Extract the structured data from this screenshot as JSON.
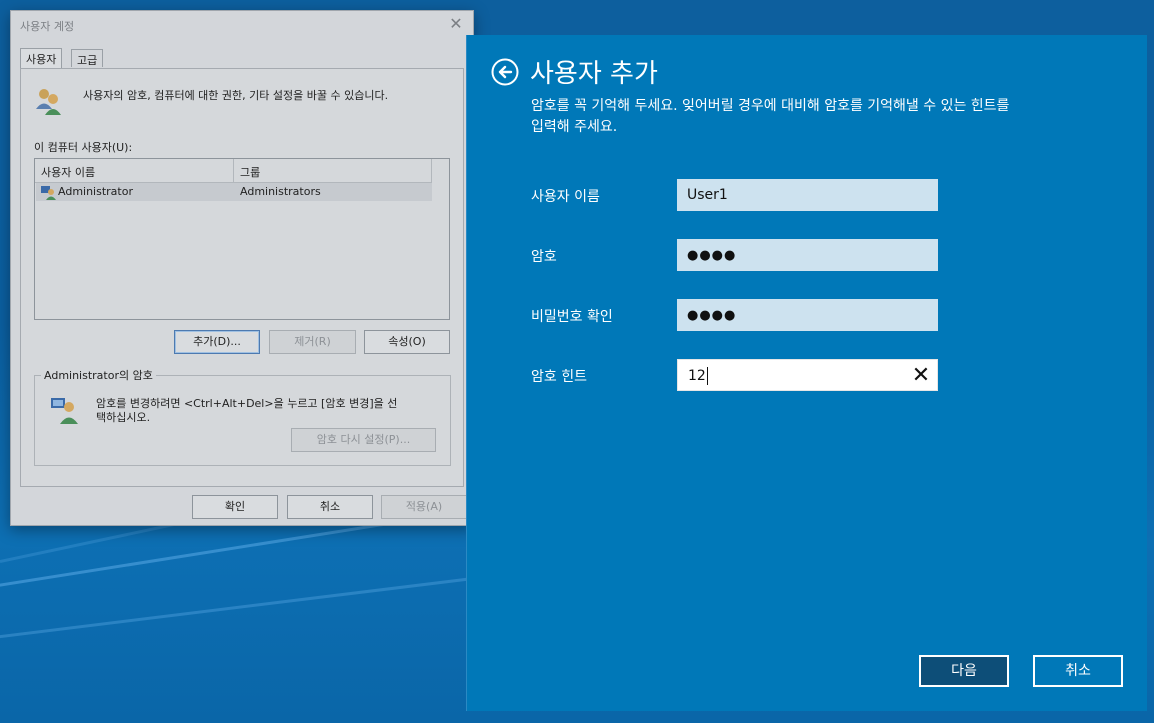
{
  "colors": {
    "desktop": "#0b5fa0",
    "modern_panel": "#0078b8",
    "field_bg": "#cde2ef",
    "next_button_bg": "#0d4e78"
  },
  "dialog": {
    "title": "사용자 계정",
    "close_icon": "close-icon",
    "tabs": [
      {
        "label": "사용자"
      },
      {
        "label": "고급"
      }
    ],
    "description": "사용자의 암호, 컴퓨터에 대한 권한, 기타 설정을 바꿀 수 있습니다.",
    "users_label": "이 컴퓨터 사용자(U):",
    "columns": [
      "사용자 이름",
      "그룹"
    ],
    "rows": [
      {
        "name": "Administrator",
        "group": "Administrators"
      }
    ],
    "buttons": {
      "add": "추가(D)...",
      "remove": "제거(R)",
      "properties": "속성(O)"
    },
    "password_group": {
      "label": "Administrator의 암호",
      "text_line1": "암호를 변경하려면 <Ctrl+Alt+Del>을 누르고 [암호 변경]을 선",
      "text_line2": "택하십시오.",
      "reset_button": "암호 다시 설정(P)..."
    },
    "footer": {
      "ok": "확인",
      "cancel": "취소",
      "apply": "적용(A)"
    }
  },
  "add_user": {
    "back_icon": "back-arrow-icon",
    "title": "사용자 추가",
    "instruction_line1": "암호를 꼭 기억해 두세요. 잊어버릴 경우에 대비해 암호를 기억해낼 수 있는 힌트를",
    "instruction_line2": "입력해 주세요.",
    "fields": {
      "username": {
        "label": "사용자 이름",
        "value": "User1"
      },
      "password": {
        "label": "암호",
        "value": "●●●●"
      },
      "confirm": {
        "label": "비밀번호 확인",
        "value": "●●●●"
      },
      "hint": {
        "label": "암호 힌트",
        "value": "12"
      }
    },
    "buttons": {
      "next": "다음",
      "cancel": "취소"
    }
  }
}
